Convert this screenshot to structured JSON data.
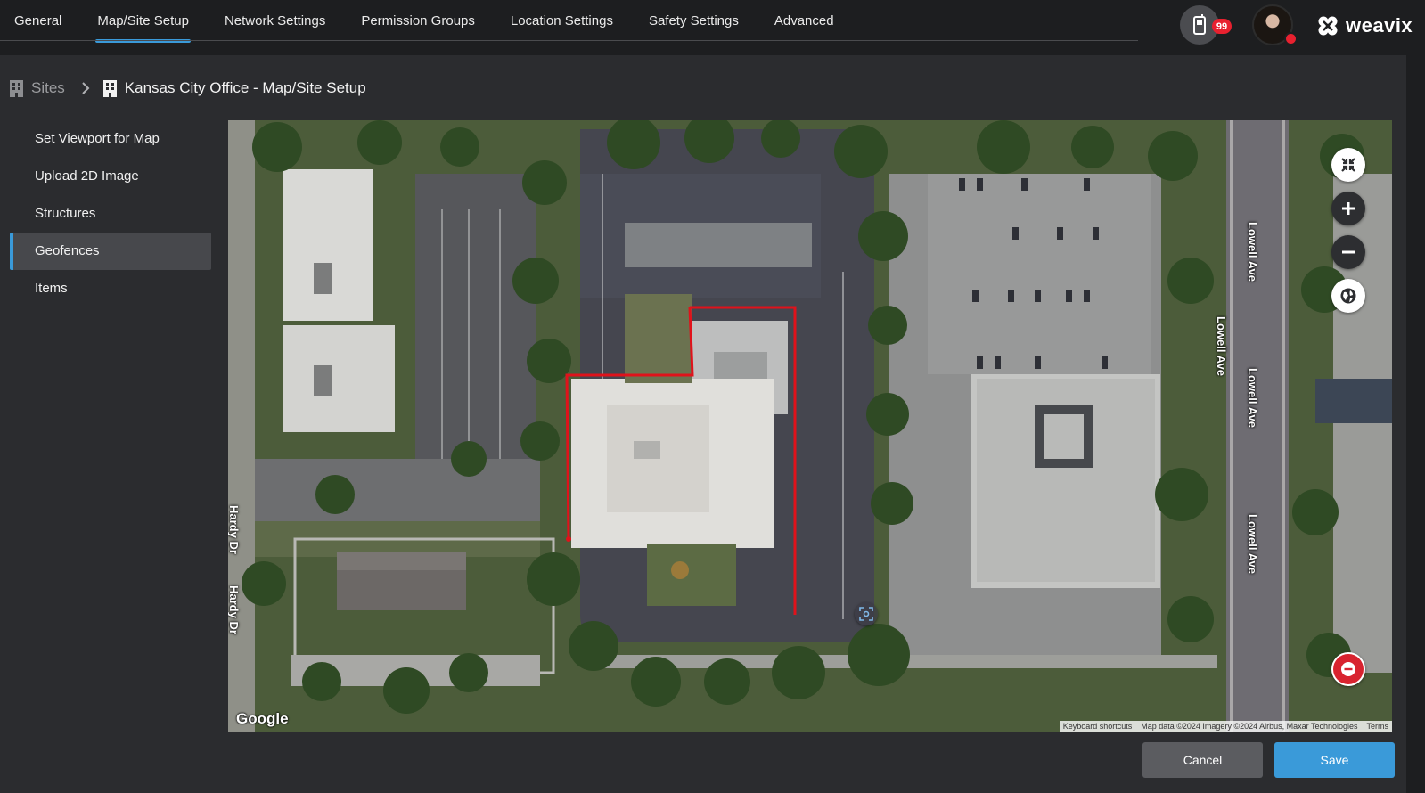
{
  "nav": {
    "tabs": [
      {
        "label": "General",
        "active": false
      },
      {
        "label": "Map/Site Setup",
        "active": true
      },
      {
        "label": "Network Settings",
        "active": false
      },
      {
        "label": "Permission Groups",
        "active": false
      },
      {
        "label": "Location Settings",
        "active": false
      },
      {
        "label": "Safety Settings",
        "active": false
      },
      {
        "label": "Advanced",
        "active": false
      }
    ],
    "device_badge": "99",
    "logo_text": "weavix",
    "accent_color": "#3a9ad9",
    "badge_color": "#e8212f"
  },
  "breadcrumb": {
    "root": "Sites",
    "current": "Kansas City Office - Map/Site Setup"
  },
  "sidenav": {
    "items": [
      {
        "label": "Set Viewport for Map",
        "active": false
      },
      {
        "label": "Upload 2D Image",
        "active": false
      },
      {
        "label": "Structures",
        "active": false
      },
      {
        "label": "Geofences",
        "active": true
      },
      {
        "label": "Items",
        "active": false
      }
    ]
  },
  "map": {
    "google_logo": "Google",
    "attribution": {
      "keyboard": "Keyboard shortcuts",
      "data": "Map data ©2024 Imagery ©2024 Airbus, Maxar Technologies",
      "terms": "Terms"
    },
    "streets": {
      "hardy_1": "Hardy Dr",
      "hardy_2": "Hardy Dr",
      "lowell_1": "Lowell Ave",
      "lowell_2": "Lowell Ave",
      "lowell_3": "Lowell Ave",
      "lowell_4": "Lowell Ave"
    },
    "geofence_color": "#e0121b",
    "controls": [
      "collapse-icon",
      "zoom-in-icon",
      "zoom-out-icon",
      "globe-icon",
      "remove-icon"
    ]
  },
  "footer": {
    "cancel_label": "Cancel",
    "save_label": "Save"
  }
}
